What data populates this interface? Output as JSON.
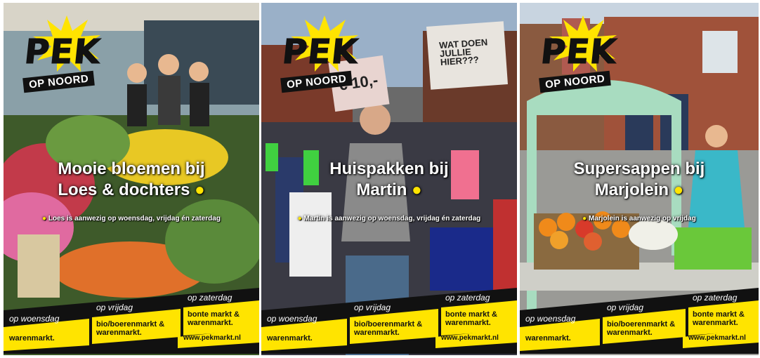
{
  "brand": {
    "name": "PEK",
    "tagline": "OP NOORD"
  },
  "posters": [
    {
      "headline1": "Mooie bloemen bij",
      "headline2": "Loes & dochters",
      "sub": "Loes is aanwezig op woensdag, vrijdag én zaterdag"
    },
    {
      "headline1": "Huispakken bij",
      "headline2": "Martin",
      "sub": "Martin is aanwezig op woensdag, vrijdag én zaterdag",
      "sign1": "WAT DOEN JULLIE HIER???",
      "sign2": "€ 10,-"
    },
    {
      "headline1": "Supersappen bij",
      "headline2": "Marjolein",
      "sub": "Marjolein is aanwezig op vrijdag"
    }
  ],
  "schedule": {
    "wed_day": "op woensdag",
    "wed_market": "warenmarkt.",
    "fri_day": "op vrijdag",
    "fri_market1": "bio/boerenmarkt &",
    "fri_market2": "warenmarkt.",
    "sat_day": "op zaterdag",
    "sat_market1": "bonte markt &",
    "sat_market2": "warenmarkt.",
    "url": "www.pekmarkt.nl"
  },
  "colors": {
    "accent": "#ffe400",
    "dark": "#111111"
  }
}
